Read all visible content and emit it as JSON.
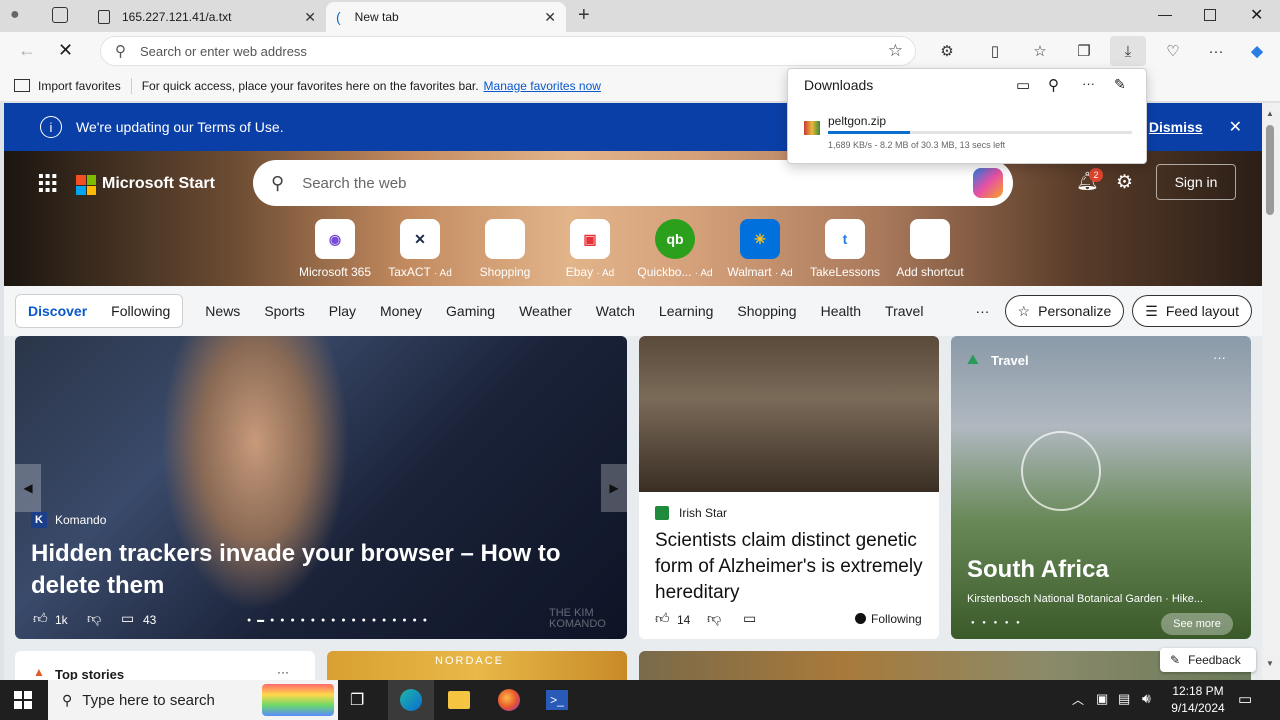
{
  "tabs": [
    {
      "title": "165.227.121.41/a.txt"
    },
    {
      "title": "New tab"
    }
  ],
  "address": {
    "placeholder": "Search or enter web address"
  },
  "favbar": {
    "import": "Import favorites",
    "hint": "For quick access, place your favorites here on the favorites bar.",
    "manage": "Manage favorites now"
  },
  "downloads": {
    "title": "Downloads",
    "file": "peltgon.zip",
    "status": "1,689 KB/s - 8.2 MB of 30.3 MB, 13 secs left",
    "progress": 0.27
  },
  "terms": {
    "text": "We're updating our Terms of Use.",
    "dismiss": "Dismiss"
  },
  "brand": {
    "name": "Microsoft Start",
    "search_placeholder": "Search the web",
    "notif_count": "2",
    "signin": "Sign in"
  },
  "shortcuts": [
    {
      "label": "Microsoft 365",
      "ad": ""
    },
    {
      "label": "TaxACT",
      "ad": "· Ad"
    },
    {
      "label": "Shopping",
      "ad": ""
    },
    {
      "label": "Ebay",
      "ad": "· Ad"
    },
    {
      "label": "Quickbo...",
      "ad": "· Ad"
    },
    {
      "label": "Walmart",
      "ad": "· Ad"
    },
    {
      "label": "TakeLessons",
      "ad": ""
    },
    {
      "label": "Add shortcut",
      "ad": ""
    }
  ],
  "nav": {
    "discover": "Discover",
    "following": "Following",
    "items": [
      "News",
      "Sports",
      "Play",
      "Money",
      "Gaming",
      "Weather",
      "Watch",
      "Learning",
      "Shopping",
      "Health",
      "Travel"
    ],
    "more": "···",
    "personalize": "Personalize",
    "feed_layout": "Feed layout"
  },
  "main_card": {
    "source": "Komando",
    "headline": "Hidden trackers invade your browser – How to delete them",
    "likes": "1k",
    "comments": "43",
    "watermark": "THE KIM KOMANDO"
  },
  "card2": {
    "source": "Irish Star",
    "headline": "Scientists claim distinct genetic form of Alzheimer's is extremely hereditary",
    "likes": "14",
    "following": "Following"
  },
  "card3": {
    "category": "Travel",
    "title": "South Africa",
    "subtitle": "Kirstenbosch National Botanical Garden · Hike...",
    "see_more": "See more"
  },
  "bottom": {
    "top_stories": "Top stories",
    "nordace": "NORDACE",
    "feedback": "Feedback"
  },
  "taskbar": {
    "search": "Type here to search",
    "time": "12:18 PM",
    "date": "9/14/2024"
  }
}
